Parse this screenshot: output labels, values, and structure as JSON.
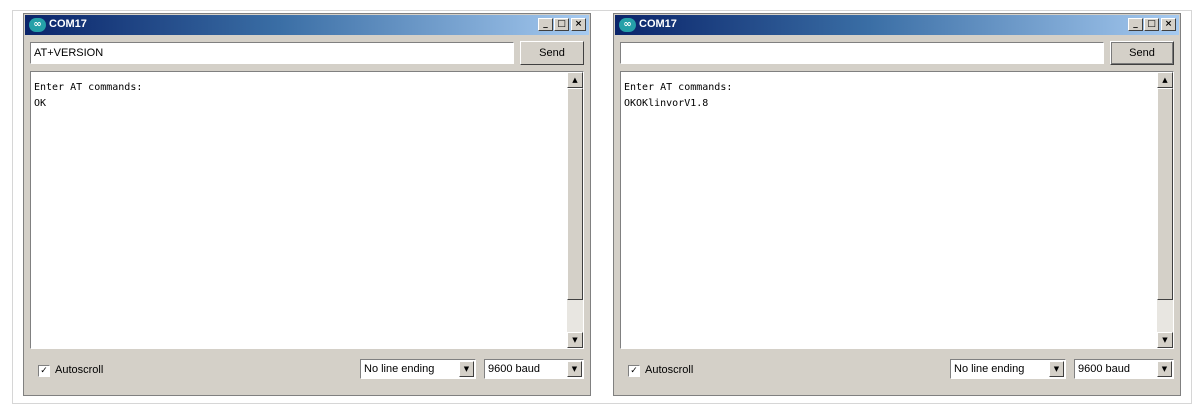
{
  "windows": [
    {
      "title": "COM17",
      "app_icon_glyph": "∞",
      "caption_buttons": {
        "minimize": "_",
        "maximize": "□",
        "close": "×"
      },
      "command_input": {
        "value": "AT+VERSION"
      },
      "send_label": "Send",
      "output": "Enter AT commands:\nOK",
      "autoscroll": {
        "label": "Autoscroll",
        "checked": true,
        "glyph": "✓"
      },
      "line_ending": {
        "selected": "No line ending"
      },
      "baud": {
        "selected": "9600 baud"
      },
      "icons": [
        "arduino-infinity-icon",
        "minimize-icon",
        "maximize-icon",
        "close-icon",
        "scroll-up-arrow-icon",
        "scroll-down-arrow-icon",
        "dropdown-arrow-icon"
      ]
    },
    {
      "title": "COM17",
      "app_icon_glyph": "∞",
      "caption_buttons": {
        "minimize": "_",
        "maximize": "□",
        "close": "×"
      },
      "command_input": {
        "value": ""
      },
      "send_label": "Send",
      "output": "Enter AT commands:\nOKOKlinvorV1.8",
      "autoscroll": {
        "label": "Autoscroll",
        "checked": true,
        "glyph": "✓"
      },
      "line_ending": {
        "selected": "No line ending"
      },
      "baud": {
        "selected": "9600 baud"
      },
      "icons": [
        "arduino-infinity-icon",
        "minimize-icon",
        "maximize-icon",
        "close-icon",
        "scroll-up-arrow-icon",
        "scroll-down-arrow-icon",
        "dropdown-arrow-icon"
      ]
    }
  ],
  "colors": {
    "titlebar_start": "#0a246a",
    "titlebar_end": "#a6caf0",
    "window_face": "#d4d0c8",
    "arduino_teal": "#25a0a8"
  }
}
